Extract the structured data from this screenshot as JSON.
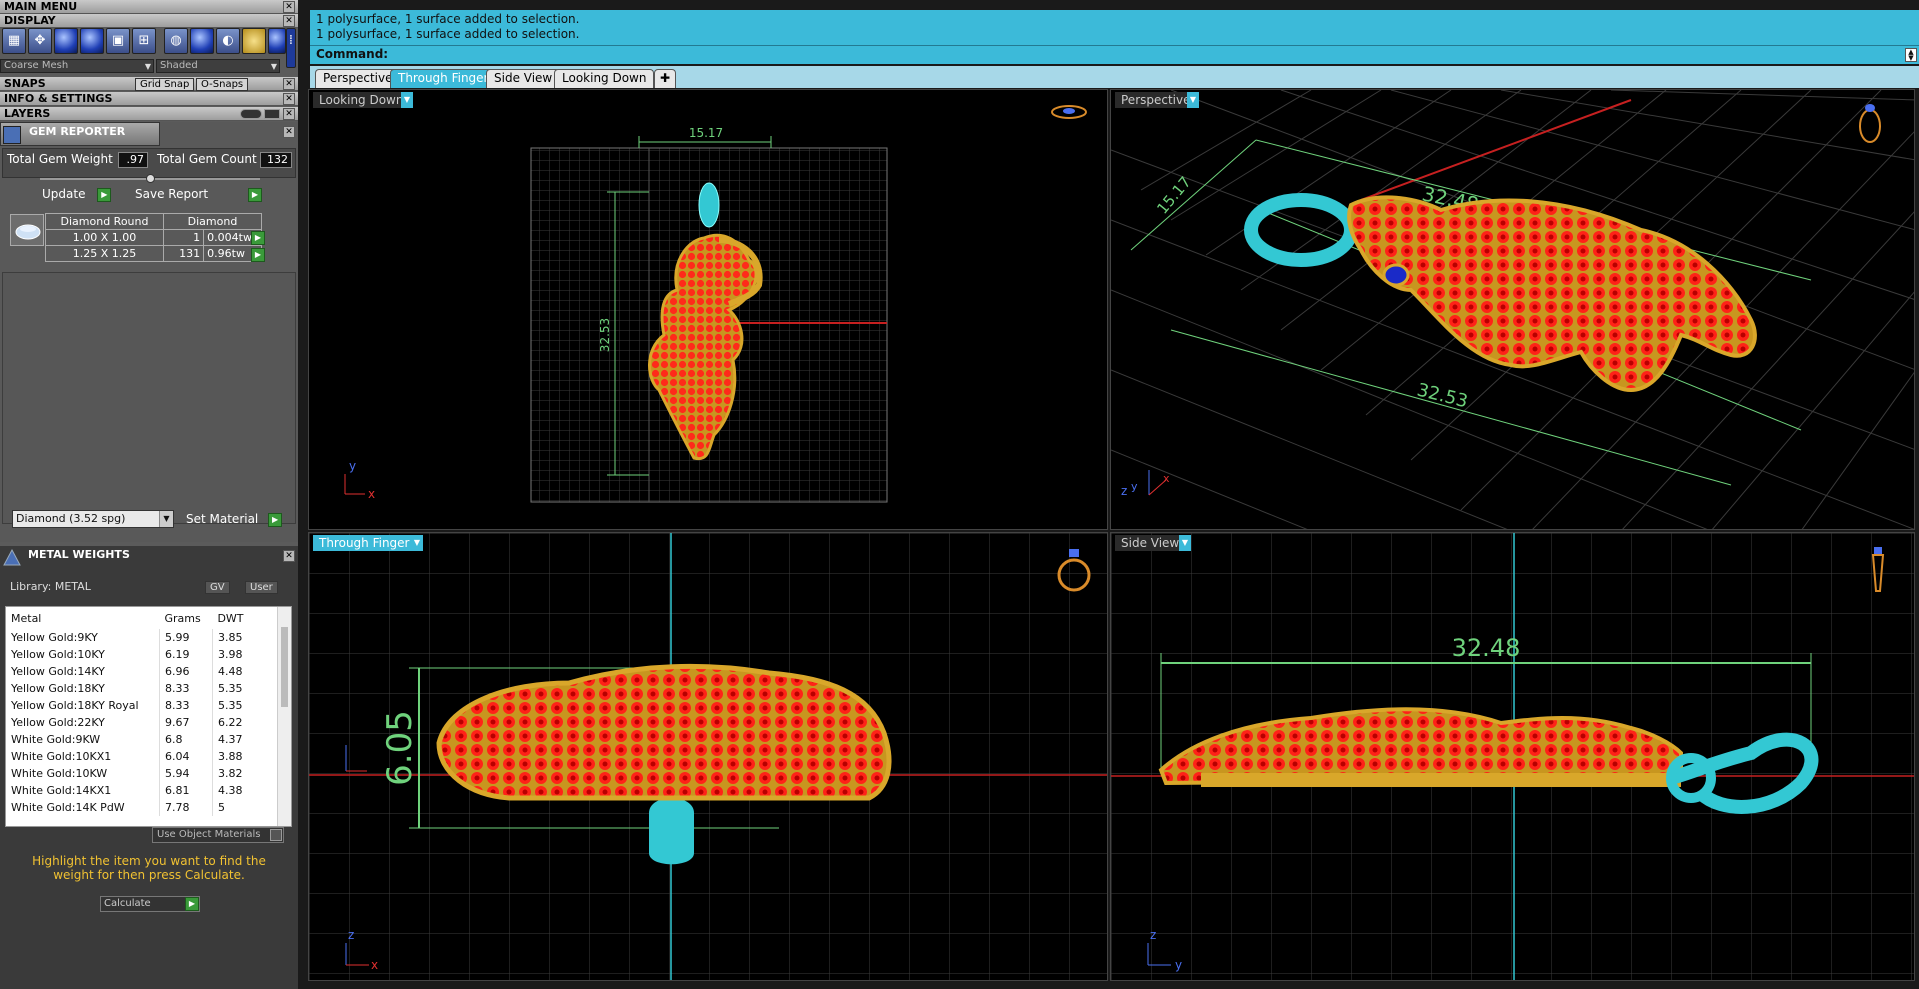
{
  "left_panel": {
    "main_menu": "MAIN MENU",
    "display": "DISPLAY",
    "mesh_select": "Coarse Mesh",
    "shade_select": "Shaded",
    "snaps": "SNAPS",
    "grid_snap": "Grid Snap",
    "o_snaps": "O-Snaps",
    "info_settings": "INFO & SETTINGS",
    "layers": "LAYERS"
  },
  "gem_reporter": {
    "title": "GEM REPORTER",
    "total_weight_label": "Total Gem Weight",
    "total_weight_value": ".97",
    "total_count_label": "Total Gem Count",
    "total_count_value": "132",
    "update_label": "Update",
    "save_report_label": "Save Report",
    "table_header": [
      "Diamond Round",
      "Diamond"
    ],
    "rows": [
      {
        "size": "1.00 X 1.00",
        "count": "1",
        "weight": "0.004tw"
      },
      {
        "size": "1.25 X 1.25",
        "count": "131",
        "weight": "0.96tw"
      }
    ],
    "material_select": "Diamond   (3.52 spg)",
    "set_material_label": "Set Material"
  },
  "metal_weights": {
    "title": "METAL WEIGHTS",
    "library_label": "Library: METAL",
    "gv_label": "GV",
    "user_label": "User",
    "columns": [
      "Metal",
      "Grams",
      "DWT"
    ],
    "rows": [
      [
        "Yellow Gold:9KY",
        "5.99",
        "3.85"
      ],
      [
        "Yellow Gold:10KY",
        "6.19",
        "3.98"
      ],
      [
        "Yellow Gold:14KY",
        "6.96",
        "4.48"
      ],
      [
        "Yellow Gold:18KY",
        "8.33",
        "5.35"
      ],
      [
        "Yellow Gold:18KY Royal",
        "8.33",
        "5.35"
      ],
      [
        "Yellow Gold:22KY",
        "9.67",
        "6.22"
      ],
      [
        "White Gold:9KW",
        "6.8",
        "4.37"
      ],
      [
        "White Gold:10KX1",
        "6.04",
        "3.88"
      ],
      [
        "White Gold:10KW",
        "5.94",
        "3.82"
      ],
      [
        "White Gold:14KX1",
        "6.81",
        "4.38"
      ],
      [
        "White Gold:14K PdW",
        "7.78",
        "5"
      ]
    ],
    "use_object_materials": "Use Object Materials",
    "hint": "Highlight the item you want to find the weight for then press Calculate.",
    "calculate_label": "Calculate"
  },
  "command": {
    "history": [
      "1 polysurface, 1 surface added to selection.",
      "1 polysurface, 1 surface added to selection."
    ],
    "prompt": "Command:"
  },
  "tabs": [
    "Perspective",
    "Through Finger",
    "Side View",
    "Looking Down"
  ],
  "active_tab": "Through Finger",
  "viewports": {
    "top_left": {
      "label": "Looking Down",
      "dim_width": "15.17",
      "dim_height": "32.53",
      "axis1": "y",
      "axis2": "x"
    },
    "top_right": {
      "label": "Perspective",
      "dim_a": "15.17",
      "dim_b": "32.48",
      "dim_c": "32.53",
      "axis1": "z",
      "axis2": "y",
      "axis3": "x"
    },
    "bottom_left": {
      "label": "Through Finger",
      "dim_height": "6.05",
      "axis1": "z",
      "axis2": "x"
    },
    "bottom_right": {
      "label": "Side View",
      "dim_width": "32.48",
      "axis1": "z",
      "axis2": "y"
    }
  },
  "colors": {
    "accent": "#3cbad9",
    "gem_red": "#ff2020",
    "gold": "#d4a52a",
    "cyan_bail": "#3fd8e0",
    "dimension_green": "#6fd27c"
  }
}
